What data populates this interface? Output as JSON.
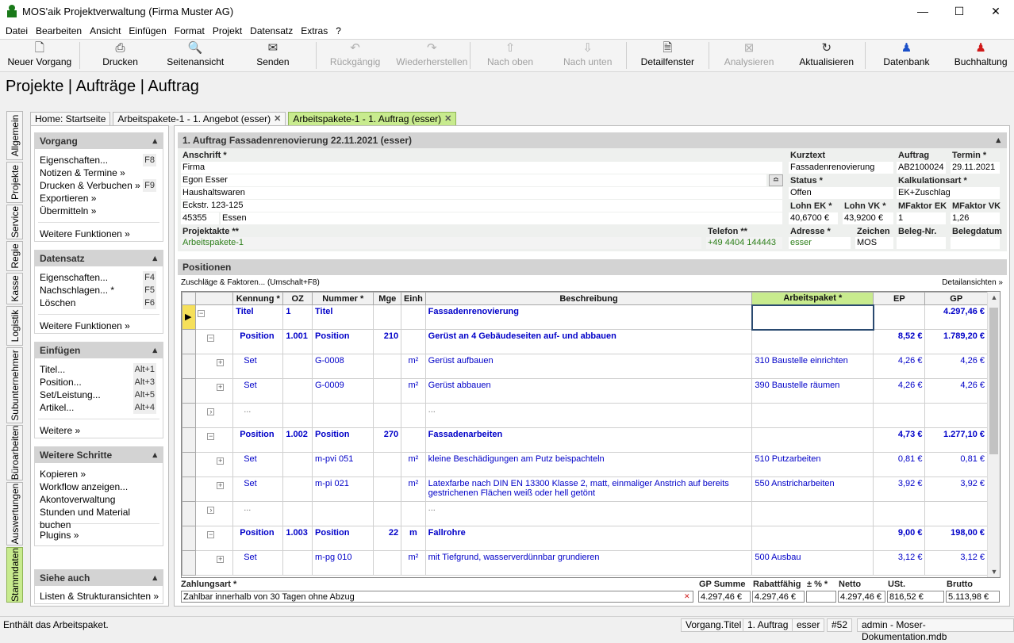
{
  "window": {
    "title": "MOS'aik Projektverwaltung (Firma Muster AG)"
  },
  "menu": [
    "Datei",
    "Bearbeiten",
    "Ansicht",
    "Einfügen",
    "Format",
    "Projekt",
    "Datensatz",
    "Extras",
    "?"
  ],
  "toolbar": [
    {
      "label": "Neuer Vorgang",
      "icon": "new-document-icon",
      "enabled": true
    },
    {
      "label": "Drucken",
      "icon": "printer-icon",
      "enabled": true
    },
    {
      "label": "Seitenansicht",
      "icon": "print-preview-icon",
      "enabled": true
    },
    {
      "label": "Senden",
      "icon": "envelope-icon",
      "enabled": true
    },
    {
      "label": "Rückgängig",
      "icon": "undo-icon",
      "enabled": false
    },
    {
      "label": "Wiederherstellen",
      "icon": "redo-icon",
      "enabled": false
    },
    {
      "label": "Nach oben",
      "icon": "arrow-up-icon",
      "enabled": false
    },
    {
      "label": "Nach unten",
      "icon": "arrow-down-icon",
      "enabled": false
    },
    {
      "label": "Detailfenster",
      "icon": "detail-window-icon",
      "enabled": true
    },
    {
      "label": "Analysieren",
      "icon": "analyze-icon",
      "enabled": false
    },
    {
      "label": "Aktualisieren",
      "icon": "refresh-icon",
      "enabled": true
    },
    {
      "label": "Datenbank",
      "icon": "database-user-icon",
      "enabled": true
    },
    {
      "label": "Buchhaltung",
      "icon": "accounting-user-icon",
      "enabled": true
    }
  ],
  "page_title": "Projekte | Aufträge | Auftrag",
  "vtabs": [
    "Allgemein",
    "Projekte",
    "Service",
    "Regie",
    "Kasse",
    "Logistik",
    "Subunternehmer",
    "Büroarbeiten",
    "Auswertungen",
    "Stammdaten"
  ],
  "vtab_active": "Stammdaten",
  "doctabs": [
    {
      "label": "Home: Startseite",
      "closable": false
    },
    {
      "label": "Arbeitspakete-1 - 1. Angebot (esser)",
      "closable": true
    },
    {
      "label": "Arbeitspakete-1 - 1. Auftrag (esser)",
      "closable": true,
      "active": true
    }
  ],
  "panels": {
    "vorgang": {
      "title": "Vorgang",
      "items": [
        {
          "label": "Eigenschaften...",
          "shortcut": "F8"
        },
        {
          "label": "Notizen & Termine »"
        },
        {
          "label": "Drucken & Verbuchen »",
          "shortcut": "F9"
        },
        {
          "label": "Exportieren »"
        },
        {
          "label": "Übermitteln »"
        }
      ],
      "more": "Weitere Funktionen »"
    },
    "datensatz": {
      "title": "Datensatz",
      "items": [
        {
          "label": "Eigenschaften...",
          "shortcut": "F4"
        },
        {
          "label": "Nachschlagen... *",
          "shortcut": "F5"
        },
        {
          "label": "Löschen",
          "shortcut": "F6"
        }
      ],
      "more": "Weitere Funktionen »"
    },
    "einfuegen": {
      "title": "Einfügen",
      "items": [
        {
          "label": "Titel...",
          "shortcut": "Alt+1"
        },
        {
          "label": "Position...",
          "shortcut": "Alt+3"
        },
        {
          "label": "Set/Leistung...",
          "shortcut": "Alt+5"
        },
        {
          "label": "Artikel...",
          "shortcut": "Alt+4"
        }
      ],
      "more": "Weitere »"
    },
    "schritte": {
      "title": "Weitere Schritte",
      "items": [
        {
          "label": "Kopieren »"
        },
        {
          "label": "Workflow anzeigen..."
        },
        {
          "label": "Akontoverwaltung"
        },
        {
          "label": "Stunden und Material buchen"
        }
      ],
      "more": "Plugins »"
    },
    "siehe": {
      "title": "Siehe auch",
      "items": [
        {
          "label": "Listen & Strukturansichten »"
        }
      ]
    }
  },
  "order": {
    "header": "1. Auftrag Fassadenrenovierung 22.11.2021 (esser)",
    "anschrift_label": "Anschrift *",
    "anschrift": [
      "Firma",
      "Egon Esser",
      "Haushaltswaren",
      "Eckstr. 123-125"
    ],
    "plz": "45355",
    "ort": "Essen",
    "kurztext_label": "Kurztext",
    "kurztext": "Fassadenrenovierung",
    "auftrag_label": "Auftrag",
    "auftrag": "AB2100024",
    "termin_label": "Termin *",
    "termin": "29.11.2021",
    "status_label": "Status *",
    "status": "Offen",
    "kalk_label": "Kalkulationsart *",
    "kalk": "EK+Zuschlag",
    "lohnek_label": "Lohn EK *",
    "lohnek": "40,6700 €",
    "lohnvk_label": "Lohn VK *",
    "lohnvk": "43,9200 €",
    "mfek_label": "MFaktor EK",
    "mfek": "1",
    "mfvk_label": "MFaktor VK",
    "mfvk": "1,26",
    "projektakte_label": "Projektakte **",
    "projektakte": "Arbeitspakete-1",
    "telefon_label": "Telefon **",
    "telefon": "+49 4404 144443",
    "adresse_label": "Adresse *",
    "adresse": "esser",
    "zeichen_label": "Zeichen",
    "zeichen": "MOS",
    "belegnr_label": "Beleg-Nr.",
    "belegnr": "",
    "belegdatum_label": "Belegdatum",
    "belegdatum": ""
  },
  "positions": {
    "title": "Positionen",
    "link_left": "Zuschläge & Faktoren... (Umschalt+F8)",
    "link_right": "Detailansichten »",
    "columns": [
      "Kennung *",
      "OZ",
      "Nummer *",
      "Mge",
      "Einh",
      "Beschreibung",
      "Arbeitspaket *",
      "EP",
      "GP"
    ],
    "rows": [
      {
        "level": 0,
        "kennung": "Titel",
        "oz": "1",
        "nummer": "Titel",
        "mge": "",
        "einh": "",
        "beschreibung": "Fassadenrenovierung",
        "apk": "",
        "ep": "",
        "gp": "4.297,46 €",
        "bold": true,
        "current": true
      },
      {
        "level": 1,
        "kennung": "Position",
        "oz": "1.001",
        "nummer": "Position",
        "mge": "210",
        "einh": "",
        "beschreibung": "Gerüst an 4 Gebäudeseiten auf- und abbauen",
        "apk": "",
        "ep": "8,52 €",
        "gp": "1.789,20 €",
        "bold": true
      },
      {
        "level": 2,
        "kennung": "Set",
        "oz": "",
        "nummer": "G-0008",
        "mge": "",
        "einh": "m²",
        "beschreibung": "Gerüst aufbauen",
        "apk": "310 Baustelle einrichten",
        "ep": "4,26 €",
        "gp": "4,26 €"
      },
      {
        "level": 2,
        "kennung": "Set",
        "oz": "",
        "nummer": "G-0009",
        "mge": "",
        "einh": "m²",
        "beschreibung": "Gerüst abbauen",
        "apk": "390 Baustelle räumen",
        "ep": "4,26 €",
        "gp": "4,26 €"
      },
      {
        "level": 3,
        "kennung": "...",
        "oz": "",
        "nummer": "",
        "mge": "",
        "einh": "",
        "beschreibung": "...",
        "apk": "",
        "ep": "",
        "gp": ""
      },
      {
        "level": 1,
        "kennung": "Position",
        "oz": "1.002",
        "nummer": "Position",
        "mge": "270",
        "einh": "",
        "beschreibung": "Fassadenarbeiten",
        "apk": "",
        "ep": "4,73 €",
        "gp": "1.277,10 €",
        "bold": true
      },
      {
        "level": 2,
        "kennung": "Set",
        "oz": "",
        "nummer": "m-pvi 051",
        "mge": "",
        "einh": "m²",
        "beschreibung": "kleine Beschädigungen am Putz beispachteln",
        "apk": "510 Putzarbeiten",
        "ep": "0,81 €",
        "gp": "0,81 €"
      },
      {
        "level": 2,
        "kennung": "Set",
        "oz": "",
        "nummer": "m-pi 021",
        "mge": "",
        "einh": "m²",
        "beschreibung": "Latexfarbe nach DIN EN 13300 Klasse 2, matt, einmaliger Anstrich auf bereits gestrichenen Flächen weiß oder hell getönt",
        "apk": "550 Anstricharbeiten",
        "ep": "3,92 €",
        "gp": "3,92 €"
      },
      {
        "level": 3,
        "kennung": "...",
        "oz": "",
        "nummer": "",
        "mge": "",
        "einh": "",
        "beschreibung": "...",
        "apk": "",
        "ep": "",
        "gp": ""
      },
      {
        "level": 1,
        "kennung": "Position",
        "oz": "1.003",
        "nummer": "Position",
        "mge": "22",
        "einh": "m",
        "beschreibung": "Fallrohre",
        "apk": "",
        "ep": "9,00 €",
        "gp": "198,00 €",
        "bold": true
      },
      {
        "level": 2,
        "kennung": "Set",
        "oz": "",
        "nummer": "m-pg 010",
        "mge": "",
        "einh": "m²",
        "beschreibung": "mit Tiefgrund, wasserverdünnbar grundieren",
        "apk": "500 Ausbau",
        "ep": "3,12 €",
        "gp": "3,12 €"
      }
    ]
  },
  "footer": {
    "zahlungsart_label": "Zahlungsart *",
    "zahlungsart": "Zahlbar innerhalb von 30 Tagen ohne Abzug",
    "gpsumme_label": "GP Summe",
    "gpsumme": "4.297,46 €",
    "rabattfaehig_label": "Rabattfähig",
    "rabattfaehig": "4.297,46 €",
    "rabatt_label": "± % *",
    "rabatt": "",
    "netto_label": "Netto",
    "netto": "4.297,46 €",
    "ust_label": "USt.",
    "ust": "816,52 €",
    "brutto_label": "Brutto",
    "brutto": "5.113,98 €"
  },
  "status": {
    "message": "Enthält das Arbeitspaket.",
    "cells": [
      "Vorgang.Titel",
      "1. Auftrag",
      "esser",
      "#52",
      "admin - Moser-Dokumentation.mdb"
    ]
  }
}
